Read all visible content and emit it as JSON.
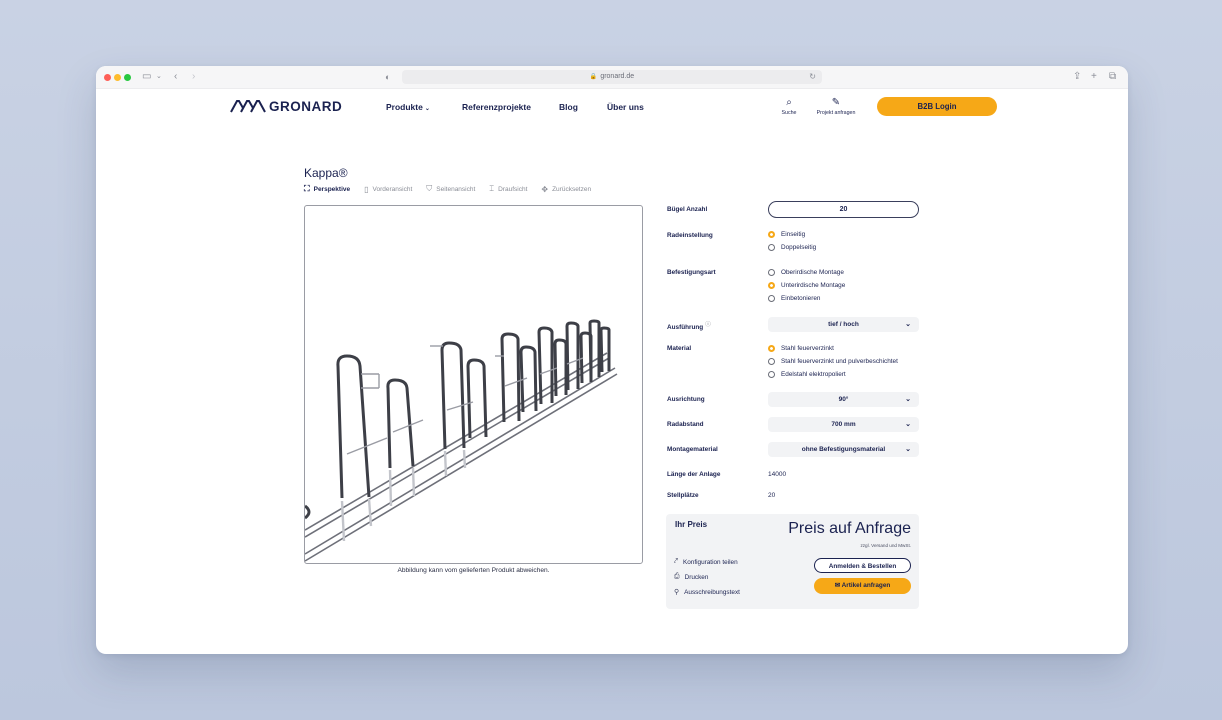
{
  "browser": {
    "url": "gronard.de"
  },
  "header": {
    "brand": "GRONARD",
    "nav": [
      "Produkte",
      "Referenzprojekte",
      "Blog",
      "Über uns"
    ],
    "search_label": "Suche",
    "project_label": "Projekt anfragen",
    "login_label": "B2B Login"
  },
  "product": {
    "title": "Kappa®",
    "views": [
      "Perspektive",
      "Vorderansicht",
      "Seitenansicht",
      "Draufsicht",
      "Zurücksetzen"
    ],
    "caption": "Abbildung kann vom gelieferten Produkt abweichen."
  },
  "config": {
    "buegel_label": "Bügel Anzahl",
    "buegel_value": "20",
    "radeinstellung_label": "Radeinstellung",
    "radeinstellung_options": [
      "Einseitig",
      "Doppelseitig"
    ],
    "befestigung_label": "Befestigungsart",
    "befestigung_options": [
      "Oberirdische Montage",
      "Unterirdische Montage",
      "Einbetonieren"
    ],
    "ausfuehrung_label": "Ausführung",
    "ausfuehrung_value": "tief / hoch",
    "material_label": "Material",
    "material_options": [
      "Stahl feuerverzinkt",
      "Stahl feuerverzinkt und pulverbeschichtet",
      "Edelstahl elektropoliert"
    ],
    "ausrichtung_label": "Ausrichtung",
    "ausrichtung_value": "90°",
    "radabstand_label": "Radabstand",
    "radabstand_value": "700 mm",
    "montagematerial_label": "Montagematerial",
    "montagematerial_value": "ohne Befestigungsmaterial",
    "laenge_label": "Länge der Anlage",
    "laenge_value": "14000",
    "stellplaetze_label": "Stellplätze",
    "stellplaetze_value": "20"
  },
  "price": {
    "label": "Ihr Preis",
    "value": "Preis auf Anfrage",
    "note": "zzgl. Versand und MwSt.",
    "links": [
      "Konfiguration teilen",
      "Drucken",
      "Ausschreibungstext"
    ],
    "login_order": "Anmelden & Bestellen",
    "request": "Artikel anfragen"
  },
  "colors": {
    "accent": "#f6a817",
    "navy": "#1b2250"
  }
}
